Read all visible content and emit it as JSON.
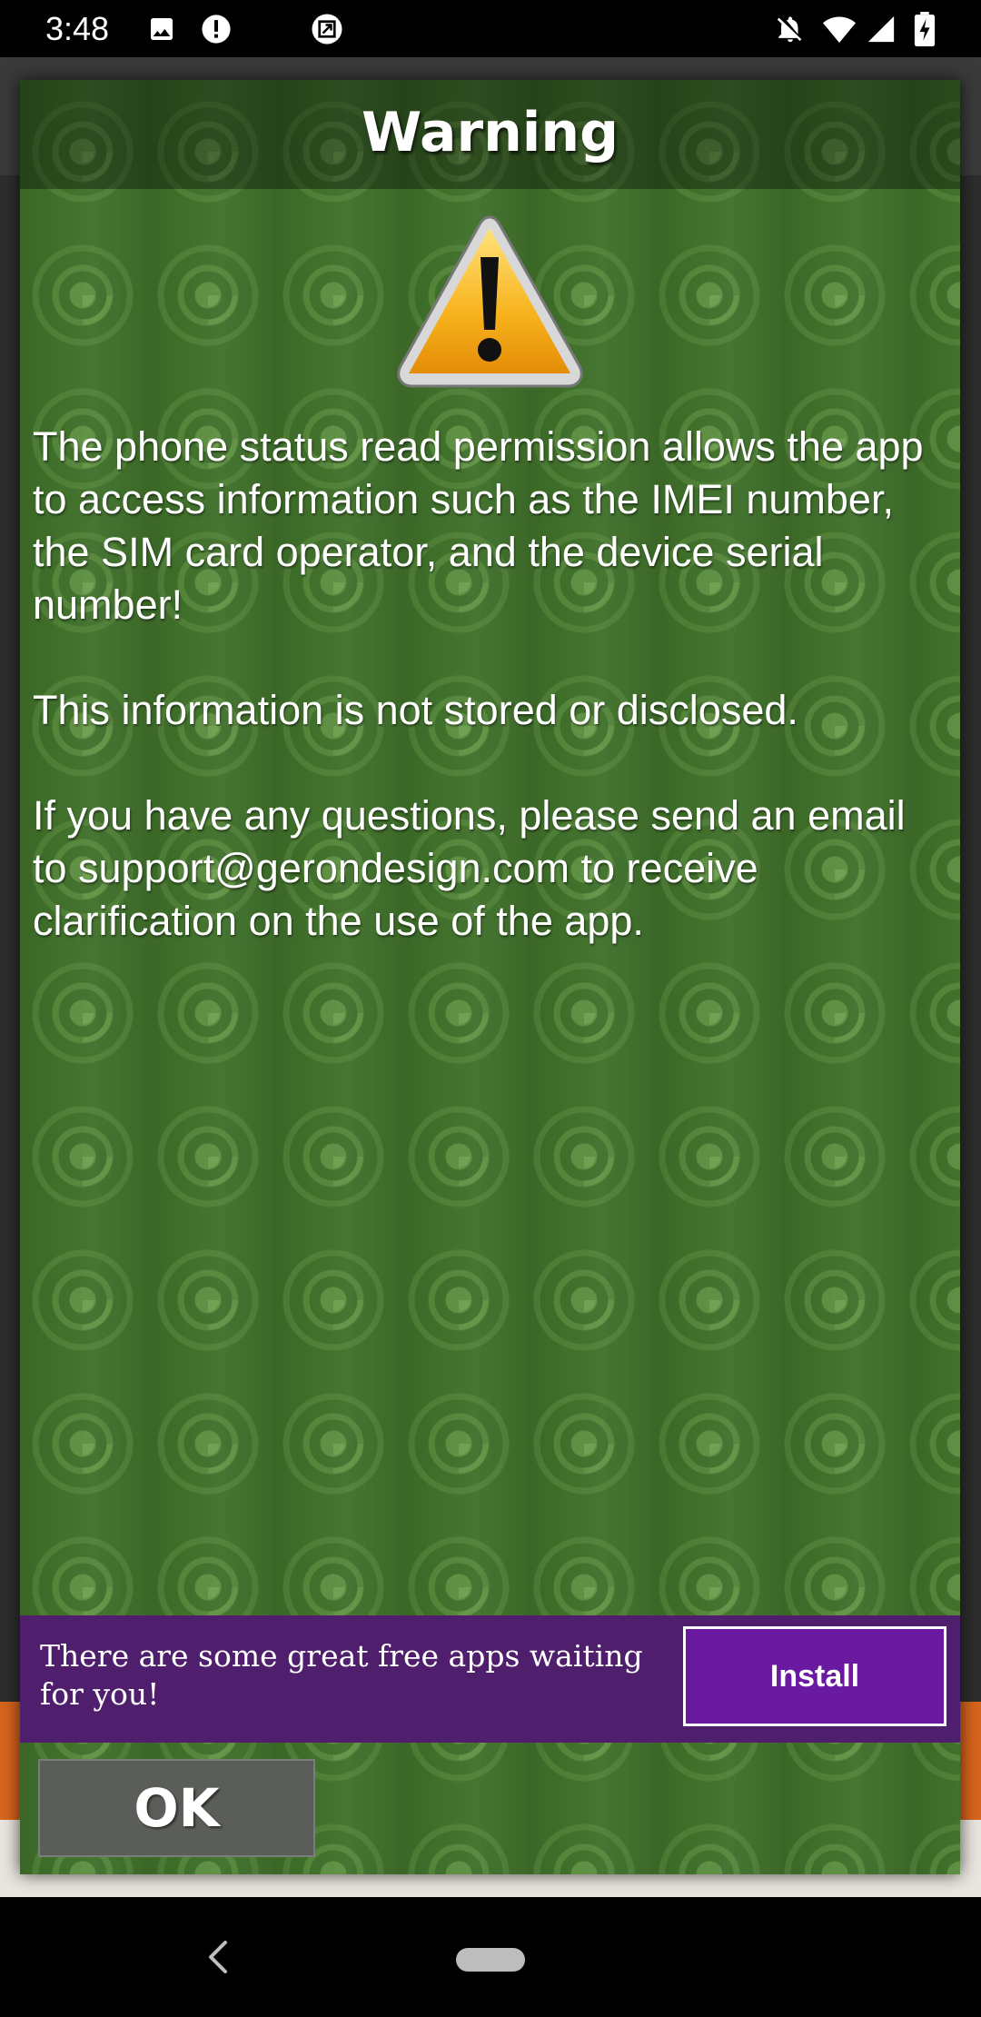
{
  "status_bar": {
    "time": "3:48",
    "icons_left": [
      "image-icon",
      "alert-icon",
      "screenshot-icon"
    ],
    "icons_right": [
      "notifications-off-icon",
      "wifi-icon",
      "signal-icon",
      "battery-charging-icon"
    ]
  },
  "dialog": {
    "title": "Warning",
    "icon": "warning-triangle-icon",
    "paragraphs": [
      "The phone status read permission allows the app to access information such as the IMEI number, the SIM card operator, and the device serial number!",
      "This information is not stored or disclosed.",
      "If you have any questions, please send an email to support@gerondesign.com to receive clarification on the use of the app."
    ],
    "ok_label": "OK"
  },
  "ad_banner": {
    "text": "There are some great free apps waiting for you!",
    "install_label": "Install",
    "background_color": "#4f1f6e",
    "button_color": "#6a1aa0"
  },
  "nav_bar": {
    "back_icon": "back-chevron-icon",
    "home_icon": "home-pill-icon"
  },
  "colors": {
    "dialog_green": "#3f6f2a",
    "text": "#ffffff"
  }
}
